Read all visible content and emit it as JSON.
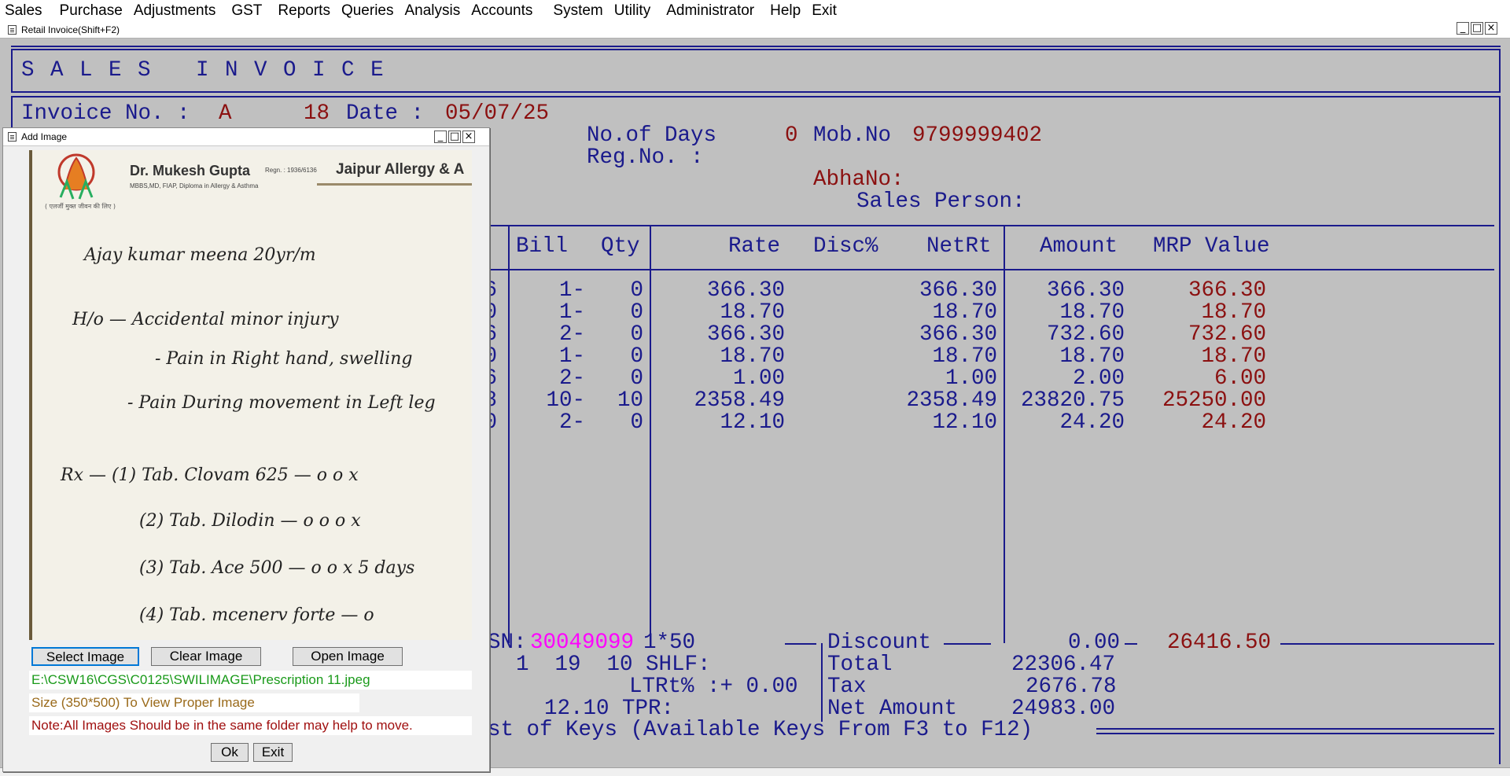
{
  "menu": [
    "Sales",
    "Purchase",
    "Adjustments",
    "GST",
    "Reports",
    "Queries",
    "Analysis",
    "Accounts",
    "System",
    "Utility",
    "Administrator",
    "Help",
    "Exit"
  ],
  "window": {
    "title": "Retail Invoice(Shift+F2)",
    "minimize": "_",
    "maximize": "□",
    "close": "×"
  },
  "invoice": {
    "heading": "S A L E S   I N V O I C E",
    "invoice_label": "Invoice No. :",
    "series": "A",
    "number": "18",
    "date_label": "Date :",
    "date": "05/07/25",
    "days_label": "No.of Days",
    "days": "0",
    "mob_label": "Mob.No",
    "mob": "9799999402",
    "reg_label": "Reg.No. :",
    "abha_label": "AbhaNo:",
    "salesperson_label": "Sales Person:"
  },
  "columns": {
    "bill": "Bill",
    "qty": "Qty",
    "rate": "Rate",
    "disc": "Disc%",
    "netrt": "NetRt",
    "amount": "Amount",
    "mrp": "MRP Value"
  },
  "rows": [
    {
      "c": "6",
      "bill": "1-",
      "qty": "0",
      "rate": "366.30",
      "netrt": "366.30",
      "amount": "366.30",
      "mrp": "366.30"
    },
    {
      "c": "0",
      "bill": "1-",
      "qty": "0",
      "rate": "18.70",
      "netrt": "18.70",
      "amount": "18.70",
      "mrp": "18.70"
    },
    {
      "c": "6",
      "bill": "2-",
      "qty": "0",
      "rate": "366.30",
      "netrt": "366.30",
      "amount": "732.60",
      "mrp": "732.60"
    },
    {
      "c": "0",
      "bill": "1-",
      "qty": "0",
      "rate": "18.70",
      "netrt": "18.70",
      "amount": "18.70",
      "mrp": "18.70"
    },
    {
      "c": "6",
      "bill": "2-",
      "qty": "0",
      "rate": "1.00",
      "netrt": "1.00",
      "amount": "2.00",
      "mrp": "6.00"
    },
    {
      "c": "8",
      "bill": "10-",
      "qty": "10",
      "rate": "2358.49",
      "netrt": "2358.49",
      "amount": "23820.75",
      "mrp": "25250.00"
    },
    {
      "c": "0",
      "bill": "2-",
      "qty": "0",
      "rate": "12.10",
      "netrt": "12.10",
      "amount": "24.20",
      "mrp": "24.20"
    }
  ],
  "footer": {
    "hsn_label": "SN:",
    "hsn_value": "30049099",
    "hsn_suffix": "1*50",
    "discount_label": "Discount",
    "discount": "0.00",
    "mrp_total": "26416.50",
    "line2": "1  19  10 SHLF:",
    "total_label": "Total",
    "total": "22306.47",
    "ltrt": "LTRt% :+ 0.00",
    "tax_label": "Tax",
    "tax": "2676.78",
    "tpr": "12.10 TPR:",
    "net_label": "Net Amount",
    "net": "24983.00",
    "keys": "st of Keys (Available Keys From F3 to F12)"
  },
  "dialog": {
    "title": "Add Image",
    "select_button": "Select Image",
    "clear_button": "Clear Image",
    "open_button": "Open Image",
    "path": "E:\\CSW16\\CGS\\C0125\\SWILIMAGE\\Prescription 11.jpeg",
    "size_note": "Size (350*500) To View Proper Image",
    "note": "Note:All Images Should be in the same folder may help to move.",
    "ok_button": "Ok",
    "exit_button": "Exit",
    "prescription": {
      "doctor": "Dr. Mukesh Gupta",
      "reg": "Regn. : 1936/6136",
      "degrees": "MBBS,MD, FIAP, Diploma in Allergy & Asthma",
      "clinic": "Jaipur Allergy & A",
      "tagline": "( एलर्जी मुक्त जीवन की लिए )",
      "hand": [
        "Ajay kumar meena 20yr/m",
        "H/o — Accidental minor injury",
        "- Pain in Right hand, swelling",
        "- Pain During movement in Left leg",
        "Rx — (1) Tab. Clovam 625 — o o x",
        "(2) Tab. Dilodin — o o o x",
        "(3) Tab. Ace 500 — o o x 5 days",
        "(4) Tab. mcenerv forte — o"
      ]
    }
  },
  "colors": {
    "navy": "#1a1a8c",
    "maroon": "#8b1010",
    "magenta": "#ff00ff",
    "path_green": "#1a9a1a",
    "size_brown": "#9a6a1a",
    "note_red": "#a01010"
  }
}
